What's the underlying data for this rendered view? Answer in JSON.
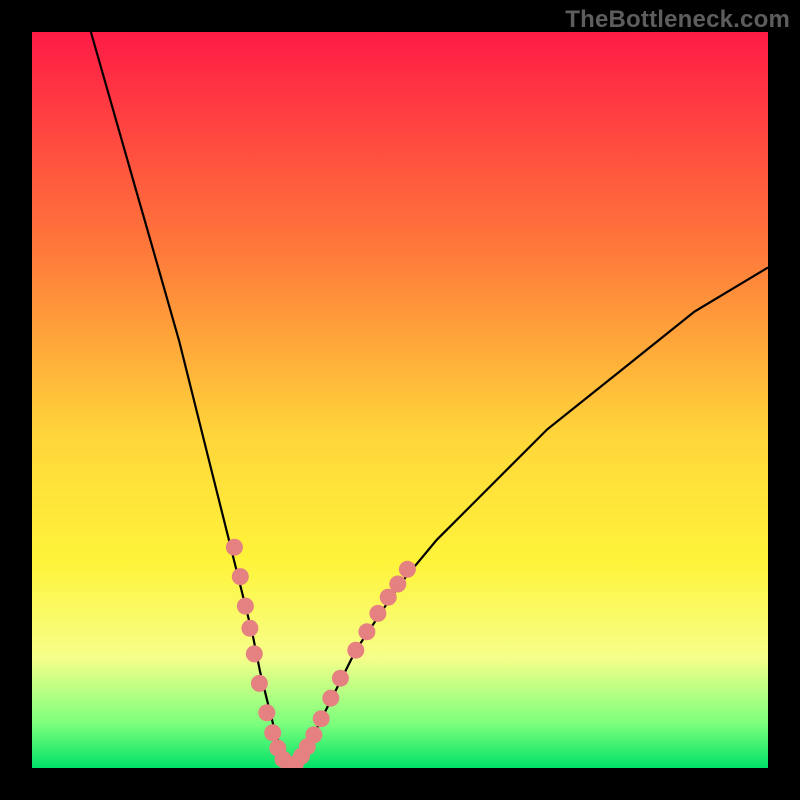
{
  "watermark": "TheBottleneck.com",
  "colors": {
    "frame": "#000000",
    "grad_top": "#ff1b46",
    "grad_mid1": "#ff7a3a",
    "grad_mid2": "#ffd63a",
    "grad_mid3": "#fff43a",
    "grad_low": "#f6ff8a",
    "grad_green1": "#7cff7c",
    "grad_green2": "#00e268",
    "curve": "#000000",
    "markers": "#e58181"
  },
  "chart_data": {
    "type": "line",
    "title": "",
    "xlabel": "",
    "ylabel": "",
    "xlim": [
      0,
      100
    ],
    "ylim": [
      0,
      100
    ],
    "series": [
      {
        "name": "bottleneck-curve",
        "x": [
          8,
          10,
          12,
          14,
          16,
          18,
          20,
          22,
          24,
          26,
          28,
          30,
          31,
          32,
          33,
          34,
          35,
          36,
          38,
          40,
          42,
          44,
          46,
          50,
          55,
          60,
          65,
          70,
          75,
          80,
          85,
          90,
          95,
          100
        ],
        "y": [
          100,
          93,
          86,
          79,
          72,
          65,
          58,
          50,
          42,
          34,
          26,
          18,
          13,
          9,
          5,
          2,
          0,
          1,
          4,
          8,
          12,
          16,
          19,
          25,
          31,
          36,
          41,
          46,
          50,
          54,
          58,
          62,
          65,
          68
        ]
      }
    ],
    "markers": {
      "name": "highlighted-points",
      "points": [
        {
          "x": 27.5,
          "y": 30
        },
        {
          "x": 28.3,
          "y": 26
        },
        {
          "x": 29.0,
          "y": 22
        },
        {
          "x": 29.6,
          "y": 19
        },
        {
          "x": 30.2,
          "y": 15.5
        },
        {
          "x": 30.9,
          "y": 11.5
        },
        {
          "x": 31.9,
          "y": 7.5
        },
        {
          "x": 32.7,
          "y": 4.8
        },
        {
          "x": 33.4,
          "y": 2.7
        },
        {
          "x": 34.1,
          "y": 1.2
        },
        {
          "x": 34.9,
          "y": 0.3
        },
        {
          "x": 35.8,
          "y": 0.6
        },
        {
          "x": 36.6,
          "y": 1.6
        },
        {
          "x": 37.4,
          "y": 2.9
        },
        {
          "x": 38.3,
          "y": 4.5
        },
        {
          "x": 39.3,
          "y": 6.7
        },
        {
          "x": 40.6,
          "y": 9.5
        },
        {
          "x": 41.9,
          "y": 12.2
        },
        {
          "x": 44.0,
          "y": 16.0
        },
        {
          "x": 45.5,
          "y": 18.5
        },
        {
          "x": 47.0,
          "y": 21.0
        },
        {
          "x": 48.4,
          "y": 23.2
        },
        {
          "x": 49.7,
          "y": 25.0
        },
        {
          "x": 51.0,
          "y": 27.0
        }
      ]
    },
    "gradient_stops": [
      {
        "pct": 0,
        "color_key": "grad_top"
      },
      {
        "pct": 30,
        "color_key": "grad_mid1"
      },
      {
        "pct": 55,
        "color_key": "grad_mid2"
      },
      {
        "pct": 72,
        "color_key": "grad_mid3"
      },
      {
        "pct": 85,
        "color_key": "grad_low"
      },
      {
        "pct": 94,
        "color_key": "grad_green1"
      },
      {
        "pct": 100,
        "color_key": "grad_green2"
      }
    ]
  }
}
